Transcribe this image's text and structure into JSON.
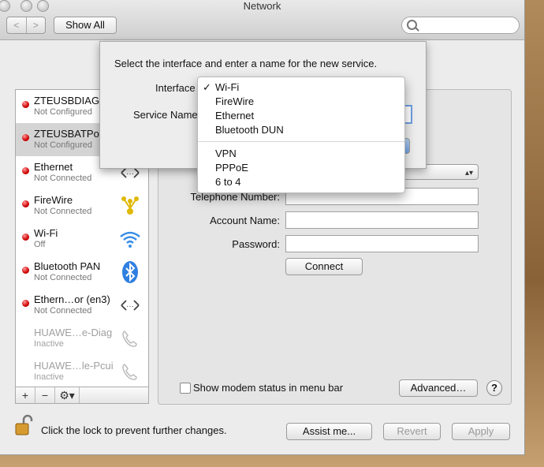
{
  "window": {
    "title": "Network"
  },
  "toolbar": {
    "back": "<",
    "forward": ">",
    "show_all": "Show All",
    "search_placeholder": ""
  },
  "services": [
    {
      "name": "ZTEUSBDIAGPort",
      "status": "Not Configured",
      "icon": "phone-icon",
      "inactive": false
    },
    {
      "name": "ZTEUSBATPort",
      "status": "Not Configured",
      "icon": "phone-icon",
      "inactive": false
    },
    {
      "name": "Ethernet",
      "status": "Not Connected",
      "icon": "ethernet-icon",
      "inactive": false
    },
    {
      "name": "FireWire",
      "status": "Not Connected",
      "icon": "firewire-icon",
      "inactive": false
    },
    {
      "name": "Wi-Fi",
      "status": "Off",
      "icon": "wifi-icon",
      "inactive": false
    },
    {
      "name": "Bluetooth PAN",
      "status": "Not Connected",
      "icon": "bluetooth-icon",
      "inactive": false
    },
    {
      "name": "Ethern…or (en3)",
      "status": "Not Connected",
      "icon": "ethernet-icon",
      "inactive": false
    },
    {
      "name": "HUAWE…e-Diag",
      "status": "Inactive",
      "icon": "phone-icon",
      "inactive": true
    },
    {
      "name": "HUAWE…le-Pcui",
      "status": "Inactive",
      "icon": "phone-icon",
      "inactive": true
    }
  ],
  "sidebar_footer": {
    "add": "+",
    "remove": "−",
    "gear": "⚙▾"
  },
  "pane": {
    "telephone_label": "Telephone Number:",
    "account_label": "Account Name:",
    "password_label": "Password:",
    "connect": "Connect",
    "show_modem_status": "Show modem status in menu bar",
    "advanced": "Advanced…",
    "help": "?"
  },
  "sheet": {
    "prompt": "Select the interface and enter a name for the new service.",
    "interface_label": "Interface",
    "service_name_label": "Service Name"
  },
  "interface_menu": {
    "selected": "Wi-Fi",
    "group1": [
      "Wi-Fi",
      "FireWire",
      "Ethernet",
      "Bluetooth DUN"
    ],
    "group2": [
      "VPN",
      "PPPoE",
      "6 to 4"
    ]
  },
  "bottom": {
    "lock_text": "Click the lock to prevent further changes.",
    "assist": "Assist me...",
    "revert": "Revert",
    "apply": "Apply"
  }
}
